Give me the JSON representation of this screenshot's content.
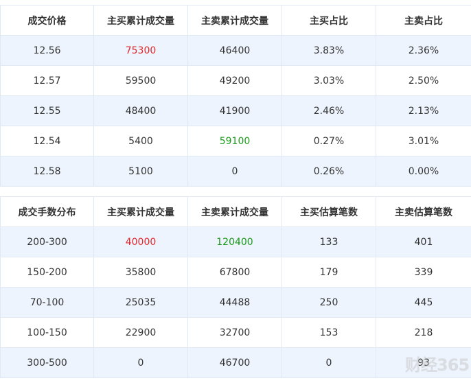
{
  "table1": {
    "headers": [
      "成交价格",
      "主买累计成交量",
      "主卖累计成交量",
      "主买占比",
      "主卖占比"
    ],
    "rows": [
      [
        "12.56",
        "75300",
        "46400",
        "3.83%",
        "2.36%"
      ],
      [
        "12.57",
        "59500",
        "49200",
        "3.03%",
        "2.50%"
      ],
      [
        "12.55",
        "48400",
        "41900",
        "2.46%",
        "2.13%"
      ],
      [
        "12.54",
        "5400",
        "59100",
        "0.27%",
        "3.01%"
      ],
      [
        "12.58",
        "5100",
        "0",
        "0.26%",
        "0.00%"
      ]
    ]
  },
  "table2": {
    "headers": [
      "成交手数分布",
      "主买累计成交量",
      "主卖累计成交量",
      "主买估算笔数",
      "主卖估算笔数"
    ],
    "rows": [
      [
        "200-300",
        "40000",
        "120400",
        "133",
        "401"
      ],
      [
        "150-200",
        "35800",
        "67800",
        "179",
        "339"
      ],
      [
        "70-100",
        "25035",
        "44488",
        "250",
        "445"
      ],
      [
        "100-150",
        "22900",
        "32700",
        "153",
        "218"
      ],
      [
        "300-500",
        "0",
        "46700",
        "0",
        "93"
      ]
    ]
  },
  "colors": {
    "highlight_max": "#e0272b",
    "highlight_sell_max": "#1a9a1a",
    "row_stripe": "#edf4fd",
    "border": "#dfe8f3"
  },
  "watermark": "财经365"
}
